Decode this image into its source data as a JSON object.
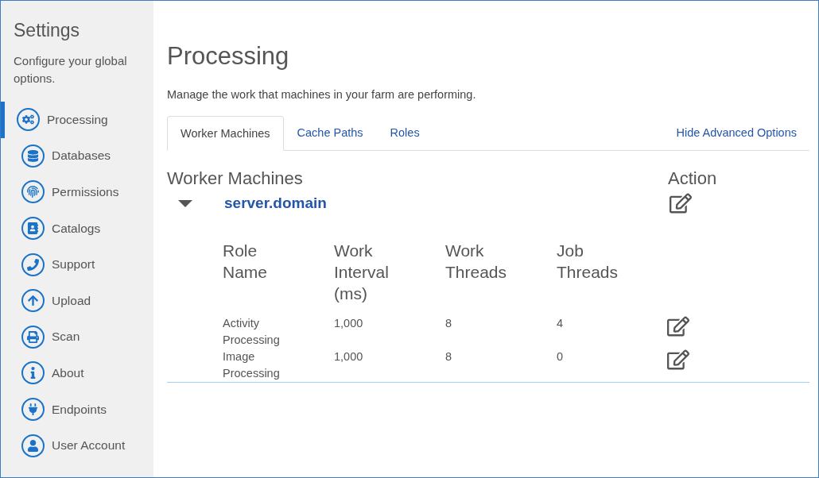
{
  "sidebar": {
    "title": "Settings",
    "subtitle": "Configure your global options.",
    "items": [
      {
        "label": "Processing",
        "selected": true
      },
      {
        "label": "Databases",
        "selected": false
      },
      {
        "label": "Permissions",
        "selected": false
      },
      {
        "label": "Catalogs",
        "selected": false
      },
      {
        "label": "Support",
        "selected": false
      },
      {
        "label": "Upload",
        "selected": false
      },
      {
        "label": "Scan",
        "selected": false
      },
      {
        "label": "About",
        "selected": false
      },
      {
        "label": "Endpoints",
        "selected": false
      },
      {
        "label": "User Account",
        "selected": false
      }
    ]
  },
  "page": {
    "title": "Processing",
    "description": "Manage the work that machines in your farm are performing."
  },
  "tabs": [
    {
      "label": "Worker Machines",
      "selected": true
    },
    {
      "label": "Cache Paths",
      "selected": false
    },
    {
      "label": "Roles",
      "selected": false
    }
  ],
  "advanced_link": "Hide Advanced Options",
  "machines_table": {
    "columns": [
      "Worker Machines",
      "Action"
    ],
    "machines": [
      {
        "name": "server.domain",
        "expanded": true,
        "role_columns": [
          "Role Name",
          "Work Interval (ms)",
          "Work Threads",
          "Job Threads"
        ],
        "roles": [
          {
            "cells": [
              "Activity Processing",
              "1,000",
              "8",
              "4"
            ]
          },
          {
            "cells": [
              "Image Processing",
              "1,000",
              "8",
              "0"
            ]
          }
        ]
      }
    ]
  }
}
